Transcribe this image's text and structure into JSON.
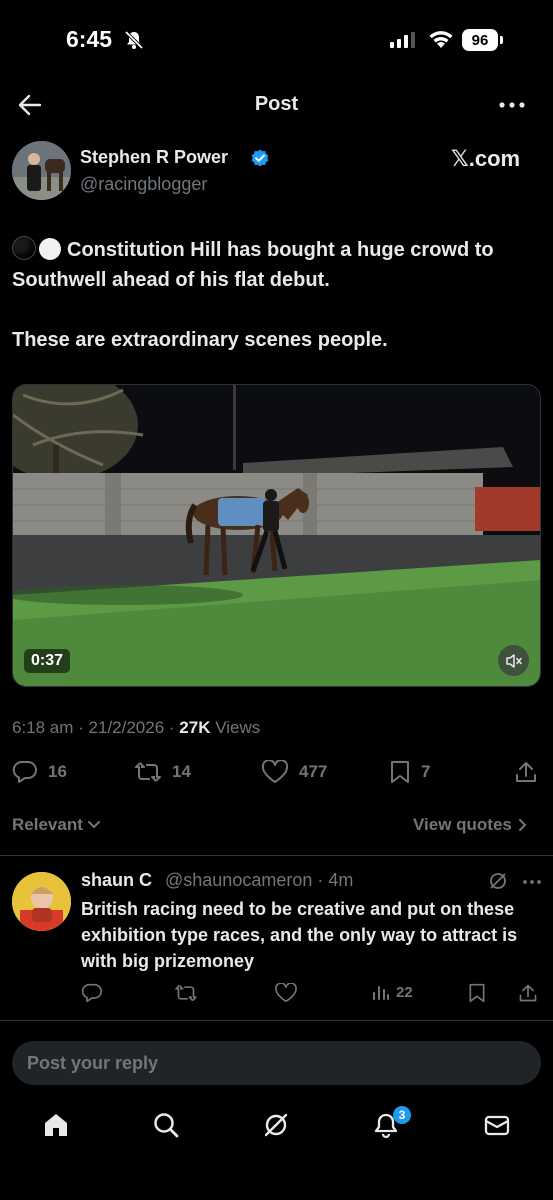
{
  "status_bar": {
    "time": "6:45",
    "battery": "96"
  },
  "header": {
    "title": "Post"
  },
  "author": {
    "name": "Stephen R Power",
    "handle": "@racingblogger",
    "verified": true,
    "source_label": "𝕏.com"
  },
  "tweet": {
    "line1": "Constitution Hill has bought a huge crowd to Southwell ahead of his flat debut.",
    "line2": "These are extraordinary scenes people.",
    "emoji": [
      "black-circle",
      "white-circle"
    ]
  },
  "video": {
    "duration": "0:37",
    "muted": true
  },
  "meta": {
    "time_date": "6:18 am · 21/2/2026 · ",
    "views_count": "27K",
    "views_label": " Views"
  },
  "actions": {
    "replies": "16",
    "reposts": "14",
    "likes": "477",
    "bookmarks": "7"
  },
  "sort": {
    "relevant_label": "Relevant",
    "view_quotes_label": "View quotes"
  },
  "reply": {
    "name": "shaun C",
    "handle_time": "@shaunocameron · 4m",
    "text": "British racing need to be creative and put on these exhibition type races, and the only way to attract is with big prizemoney",
    "views": "22"
  },
  "compose": {
    "placeholder": "Post your reply"
  },
  "nav": {
    "notifications_badge": "3"
  },
  "colors": {
    "background": "#000000",
    "text": "#e7e9ea",
    "muted": "#71767b",
    "accent": "#1d9bf0"
  }
}
